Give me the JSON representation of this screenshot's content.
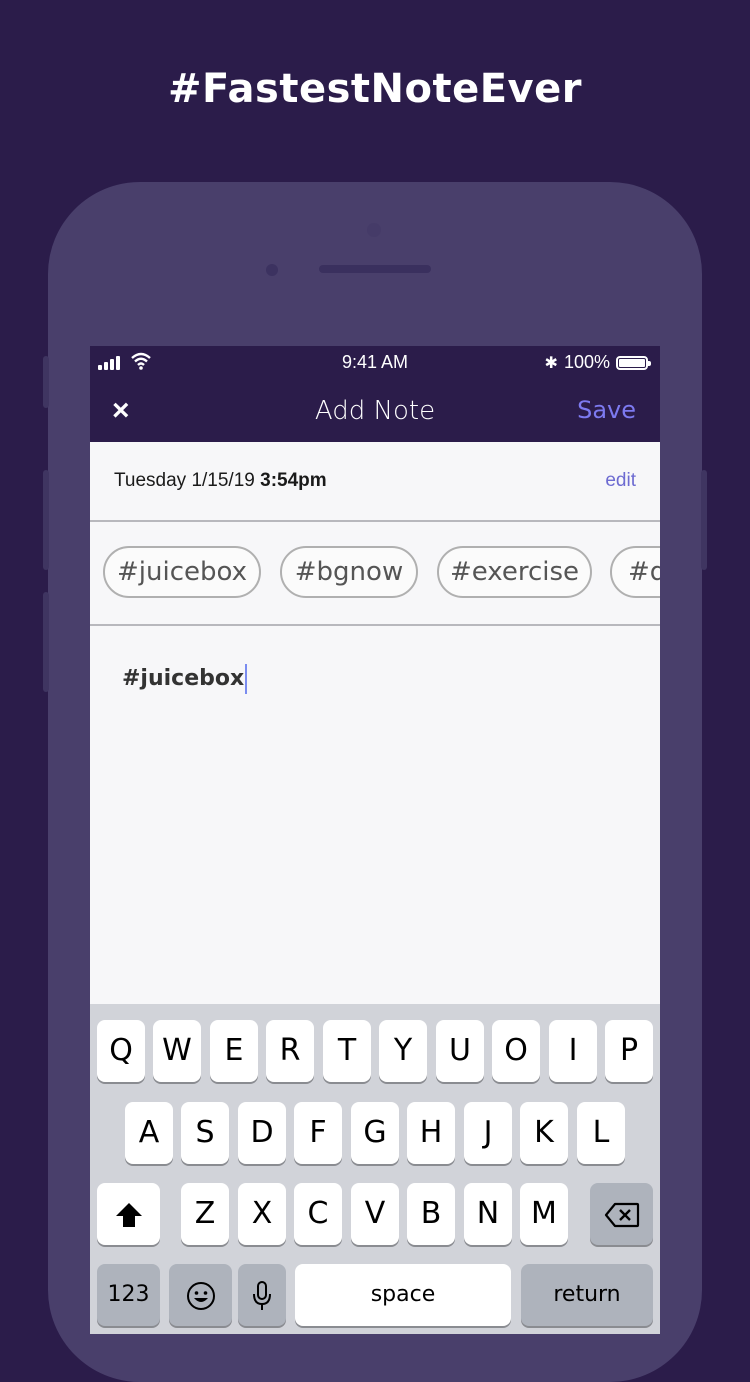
{
  "headline": "#FastestNoteEver",
  "status_bar": {
    "time": "9:41 AM",
    "bluetooth": "✱",
    "battery": "100%"
  },
  "nav": {
    "close_icon": "×",
    "title": "Add Note",
    "save_label": "Save"
  },
  "date_row": {
    "date": "Tuesday 1/15/19",
    "time": "3:54pm",
    "edit_label": "edit"
  },
  "tags": [
    "#juicebox",
    "#bgnow",
    "#exercise",
    "#d"
  ],
  "note": {
    "text": "#juicebox"
  },
  "keyboard": {
    "row1": [
      "Q",
      "W",
      "E",
      "R",
      "T",
      "Y",
      "U",
      "O",
      "I",
      "P"
    ],
    "row2": [
      "A",
      "S",
      "D",
      "F",
      "G",
      "H",
      "J",
      "K",
      "L"
    ],
    "row3": [
      "Z",
      "X",
      "C",
      "V",
      "B",
      "N",
      "M"
    ],
    "numbers_label": "123",
    "space_label": "space",
    "return_label": "return"
  }
}
